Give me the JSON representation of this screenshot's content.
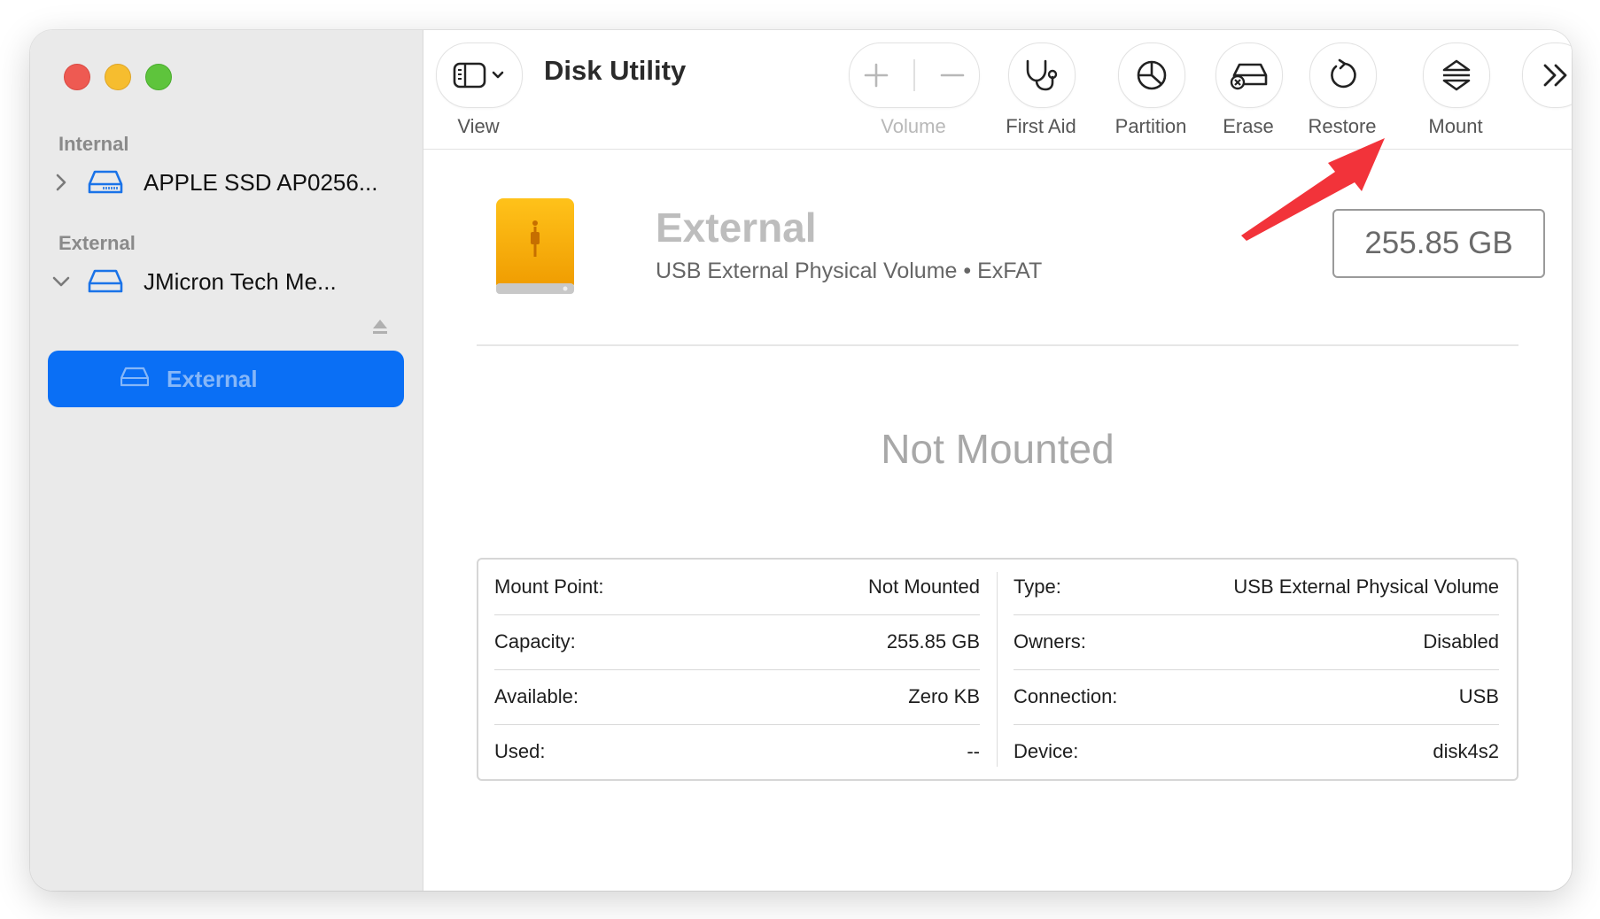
{
  "window": {
    "title": "Disk Utility"
  },
  "sidebar": {
    "sections": [
      {
        "header": "Internal",
        "items": [
          {
            "label": "APPLE SSD AP0256..."
          }
        ]
      },
      {
        "header": "External",
        "items": [
          {
            "label": "JMicron Tech Me..."
          }
        ]
      }
    ],
    "selected": {
      "label": "External"
    }
  },
  "toolbar": {
    "view_label": "View",
    "volume_label": "Volume",
    "first_aid_label": "First Aid",
    "partition_label": "Partition",
    "erase_label": "Erase",
    "restore_label": "Restore",
    "mount_label": "Mount"
  },
  "volume": {
    "name": "External",
    "subtitle": "USB External Physical Volume • ExFAT",
    "size": "255.85 GB",
    "status": "Not Mounted"
  },
  "info": {
    "left": [
      {
        "label": "Mount Point:",
        "value": "Not Mounted"
      },
      {
        "label": "Capacity:",
        "value": "255.85 GB"
      },
      {
        "label": "Available:",
        "value": "Zero KB"
      },
      {
        "label": "Used:",
        "value": "--"
      }
    ],
    "right": [
      {
        "label": "Type:",
        "value": "USB External Physical Volume"
      },
      {
        "label": "Owners:",
        "value": "Disabled"
      },
      {
        "label": "Connection:",
        "value": "USB"
      },
      {
        "label": "Device:",
        "value": "disk4s2"
      }
    ]
  },
  "colors": {
    "accent": "#0a6ff5",
    "drive_orange": "#f5a700",
    "annotation_arrow": "#f2333a"
  }
}
